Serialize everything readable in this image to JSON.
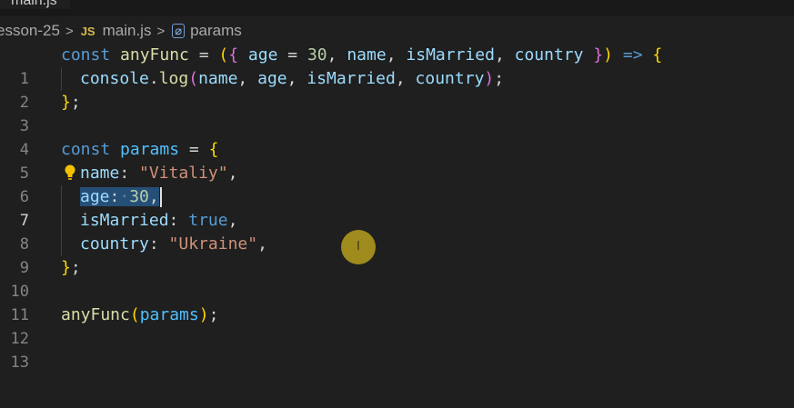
{
  "tab": {
    "label": "main.js"
  },
  "breadcrumb": {
    "folder": "esson-25",
    "separator": ">",
    "file_icon": "JS",
    "file": "main.js",
    "symbol_icon": "[⊘]",
    "symbol": "params"
  },
  "line_numbers": [
    "1",
    "2",
    "3",
    "4",
    "5",
    "6",
    "7",
    "8",
    "9",
    "10",
    "11",
    "12",
    "13"
  ],
  "code": {
    "l1": {
      "kw": "const",
      "fn": "anyFunc",
      "eq": " = ",
      "p1": "(",
      "b1": "{",
      "age": " age",
      "eq2": " = ",
      "n30": "30",
      "c1": ", ",
      "name": "name",
      "c2": ", ",
      "isMarried": "isMarried",
      "c3": ", ",
      "country": "country",
      "b2": " }",
      "p2": ")",
      "arrow": " => ",
      "b3": "{"
    },
    "l2": {
      "obj": "console",
      "dot": ".",
      "fn": "log",
      "p1": "(",
      "a1": "name",
      "c1": ", ",
      "a2": "age",
      "c2": ", ",
      "a3": "isMarried",
      "c3": ", ",
      "a4": "country",
      "p2": ")",
      "semi": ";"
    },
    "l3": {
      "b": "}",
      "semi": ";"
    },
    "l5": {
      "kw": "const",
      "var": "params",
      "eq": " = ",
      "b": "{"
    },
    "l6": {
      "key": "name",
      "colon": ": ",
      "val": "\"Vitaliy\"",
      "comma": ","
    },
    "l7": {
      "key": "age",
      "colon": ":",
      "dot": "·",
      "val": "30",
      "comma": ","
    },
    "l8": {
      "key": "isMarried",
      "colon": ": ",
      "val": "true",
      "comma": ","
    },
    "l9": {
      "key": "country",
      "colon": ": ",
      "val": "\"Ukraine\"",
      "comma": ","
    },
    "l10": {
      "b": "}",
      "semi": ";"
    },
    "l12": {
      "fn": "anyFunc",
      "p1": "(",
      "arg": "params",
      "p2": ")",
      "semi": ";"
    }
  },
  "cursor_glyph": "I",
  "icons": {
    "lightbulb": "lightbulb-icon",
    "cursor": "mouse-cursor"
  },
  "colors": {
    "keyword": "#569cd6",
    "function": "#dcdcaa",
    "variable": "#9cdcfe",
    "string": "#ce9178",
    "number": "#b5cea8",
    "selection": "#264f78"
  }
}
